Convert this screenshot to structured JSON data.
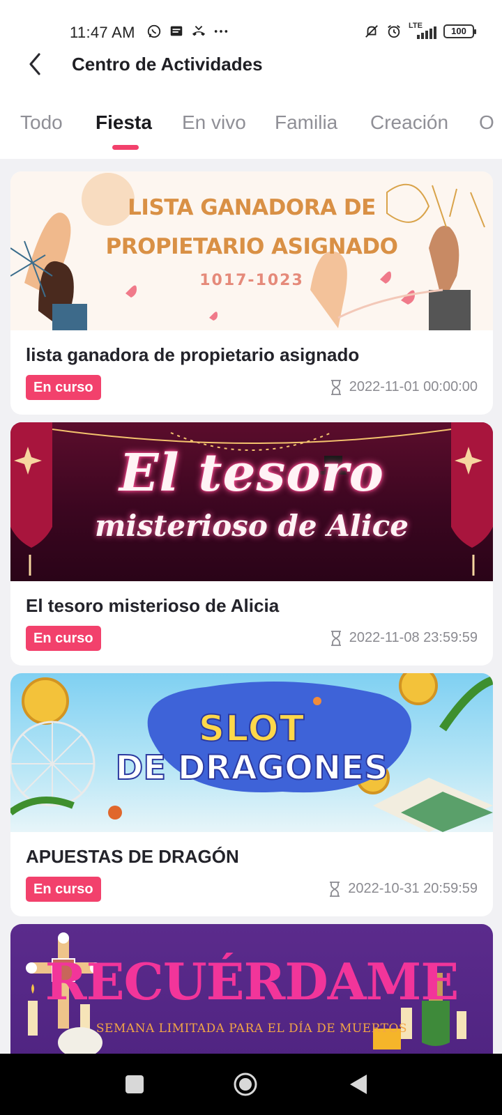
{
  "status_bar": {
    "time": "11:47 AM",
    "network": "LTE",
    "battery": "100",
    "left_icons": [
      "whatsapp-icon",
      "message-icon",
      "missed-call-icon",
      "more-dots-icon"
    ],
    "right_icons": [
      "silent-bell-icon",
      "alarm-icon",
      "lte-signal-icon",
      "battery-icon"
    ]
  },
  "header": {
    "title": "Centro de Actividades",
    "back_icon": "chevron-left-icon"
  },
  "tabs": [
    {
      "label": "Todo",
      "active": false
    },
    {
      "label": "Fiesta",
      "active": true
    },
    {
      "label": "En vivo",
      "active": false
    },
    {
      "label": "Familia",
      "active": false
    },
    {
      "label": "Creación",
      "active": false
    },
    {
      "label": "O",
      "active": false
    }
  ],
  "colors": {
    "accent": "#f2416c",
    "background": "#f1f1f4",
    "card": "#ffffff",
    "muted_text": "#8a8a90"
  },
  "cards": [
    {
      "banner": {
        "line1": "LISTA GANADORA DE",
        "line2": "PROPIETARIO ASIGNADO",
        "line3": "1017-1023"
      },
      "title": "lista ganadora de propietario asignado",
      "status": "En curso",
      "date": "2022-11-01 00:00:00"
    },
    {
      "banner": {
        "line1": "El tesoro",
        "line2": "misterioso de Alice"
      },
      "title": "El tesoro misterioso de Alicia",
      "status": "En curso",
      "date": "2022-11-08 23:59:59"
    },
    {
      "banner": {
        "line1": "SLOT",
        "line2": "DE DRAGONES"
      },
      "title": "APUESTAS DE DRAGÓN",
      "status": "En curso",
      "date": "2022-10-31 20:59:59"
    },
    {
      "banner": {
        "line1": "RECUÉRDAME",
        "line2": "SEMANA LIMITADA PARA EL DÍA DE MUERTOS"
      }
    }
  ],
  "nav_bar": {
    "icons": [
      "recent-apps-icon",
      "home-icon",
      "back-icon"
    ]
  }
}
